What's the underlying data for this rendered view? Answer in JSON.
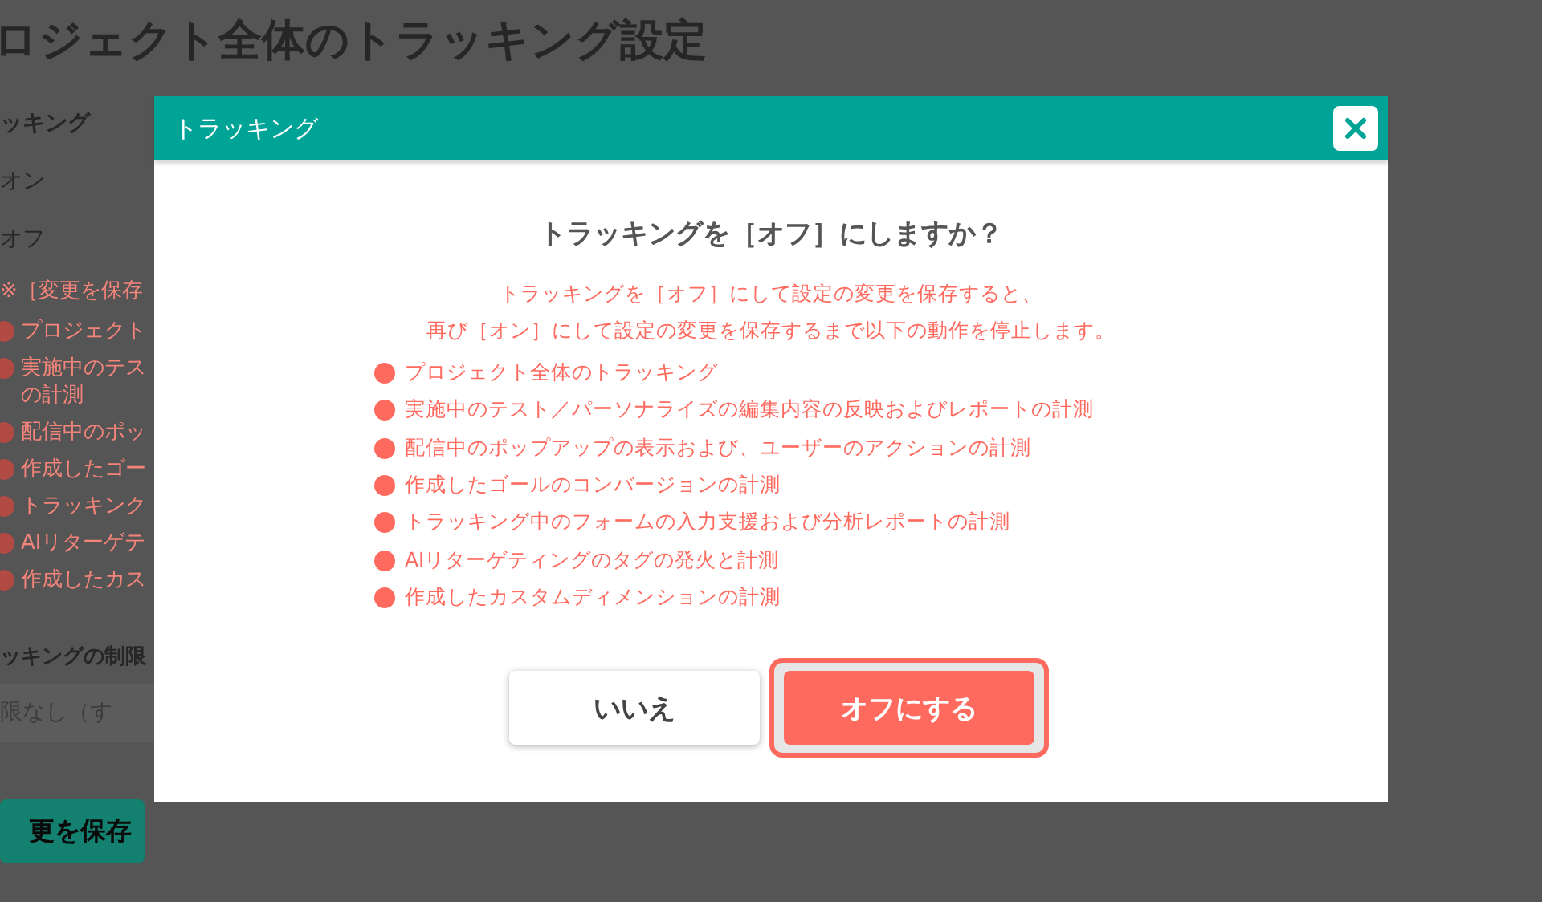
{
  "page": {
    "title": "ロジェクト全体のトラッキング設定",
    "section_label": "ッキング",
    "options": [
      "オン",
      "オフ"
    ],
    "notice": "※［変更を保存",
    "items": [
      {
        "lines": [
          "プロジェクト"
        ]
      },
      {
        "lines": [
          "実施中のテス",
          "の計測"
        ]
      },
      {
        "lines": [
          "配信中のポッ"
        ]
      },
      {
        "lines": [
          "作成したゴー"
        ]
      },
      {
        "lines": [
          "トラッキンク"
        ]
      },
      {
        "lines": [
          "AIリターゲテ"
        ]
      },
      {
        "lines": [
          "作成したカス"
        ]
      }
    ],
    "limit_label": "ッキングの制限",
    "limit_field": {
      "value": "限なし（す"
    },
    "save_button": "更を保存"
  },
  "dialog": {
    "title": "トラッキング",
    "question": "トラッキングを［オフ］にしますか？",
    "message": [
      "トラッキングを［オフ］にして設定の変更を保存すると、",
      "再び［オン］にして設定の変更を保存するまで以下の動作を停止します。"
    ],
    "items": [
      "プロジェクト全体のトラッキング",
      "実施中のテスト／パーソナライズの編集内容の反映およびレポートの計測",
      "配信中のポップアップの表示および、ユーザーのアクションの計測",
      "作成したゴールのコンバージョンの計測",
      "トラッキング中のフォームの入力支援および分析レポートの計測",
      "AIリターゲティングのタグの発火と計測",
      "作成したカスタムディメンションの計測"
    ],
    "buttons": [
      {
        "label": "いいえ",
        "kind": "secondary"
      },
      {
        "label": "オフにする",
        "kind": "primary"
      }
    ]
  }
}
